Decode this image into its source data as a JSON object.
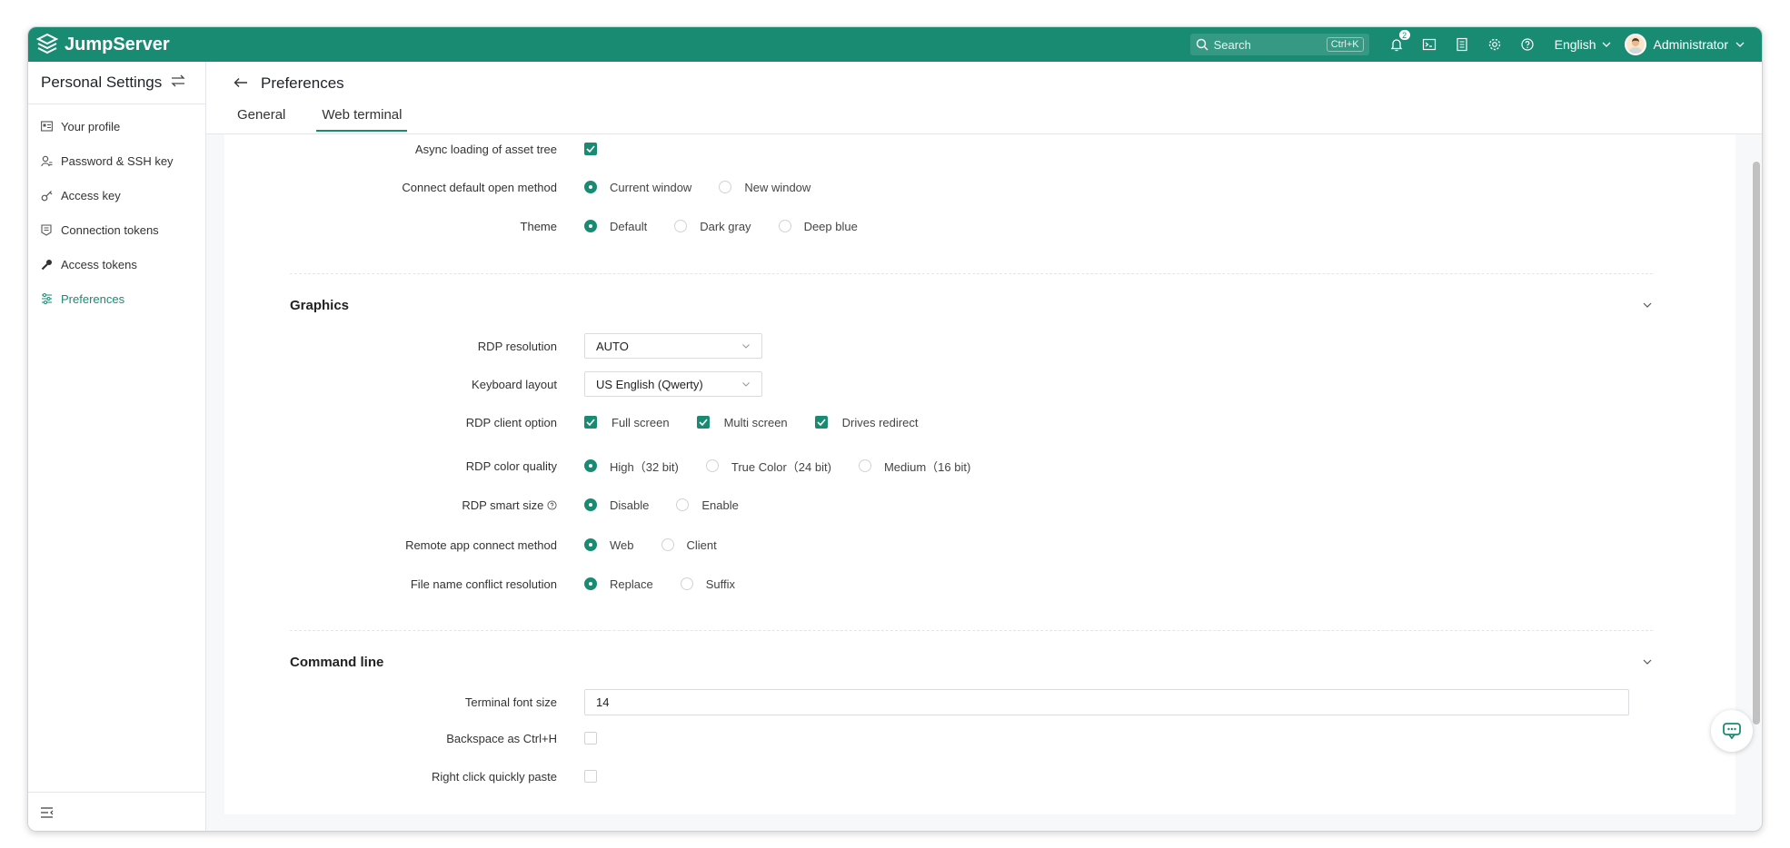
{
  "app": {
    "name": "JumpServer"
  },
  "topbar": {
    "search_label": "Search",
    "search_shortcut": "Ctrl+K",
    "notification_count": "2",
    "language": "English",
    "user": "Administrator"
  },
  "sidebar": {
    "title": "Personal Settings",
    "items": [
      {
        "label": "Your profile",
        "icon": "profile-card-icon"
      },
      {
        "label": "Password & SSH key",
        "icon": "user-key-icon"
      },
      {
        "label": "Access key",
        "icon": "key-icon"
      },
      {
        "label": "Connection tokens",
        "icon": "token-icon"
      },
      {
        "label": "Access tokens",
        "icon": "wrench-icon"
      },
      {
        "label": "Preferences",
        "icon": "sliders-icon",
        "active": true
      }
    ]
  },
  "header": {
    "title": "Preferences",
    "tabs": [
      "General",
      "Web terminal"
    ],
    "active_tab": "Web terminal"
  },
  "basic": {
    "async_label": "Async loading of asset tree",
    "async_checked": true,
    "open_method_label": "Connect default open method",
    "open_method_options": [
      "Current window",
      "New window"
    ],
    "open_method_selected": "Current window",
    "theme_label": "Theme",
    "theme_options": [
      "Default",
      "Dark gray",
      "Deep blue"
    ],
    "theme_selected": "Default"
  },
  "graphics": {
    "title": "Graphics",
    "rdp_resolution_label": "RDP resolution",
    "rdp_resolution_value": "AUTO",
    "keyboard_label": "Keyboard layout",
    "keyboard_value": "US English (Qwerty)",
    "client_option_label": "RDP client option",
    "client_options": [
      "Full screen",
      "Multi screen",
      "Drives redirect"
    ],
    "color_quality_label": "RDP color quality",
    "color_quality_options": [
      "High（32 bit)",
      "True Color（24 bit)",
      "Medium（16 bit)"
    ],
    "color_quality_selected": "High（32 bit)",
    "smart_size_label": "RDP smart size",
    "smart_size_options": [
      "Disable",
      "Enable"
    ],
    "smart_size_selected": "Disable",
    "remote_app_label": "Remote app connect method",
    "remote_app_options": [
      "Web",
      "Client"
    ],
    "remote_app_selected": "Web",
    "conflict_label": "File name conflict resolution",
    "conflict_options": [
      "Replace",
      "Suffix"
    ],
    "conflict_selected": "Replace"
  },
  "command_line": {
    "title": "Command line",
    "font_size_label": "Terminal font size",
    "font_size_value": "14",
    "backspace_label": "Backspace as Ctrl+H",
    "backspace_checked": false,
    "right_click_label": "Right click quickly paste",
    "right_click_checked": false
  },
  "colors": {
    "brand": "#1a8b73"
  }
}
